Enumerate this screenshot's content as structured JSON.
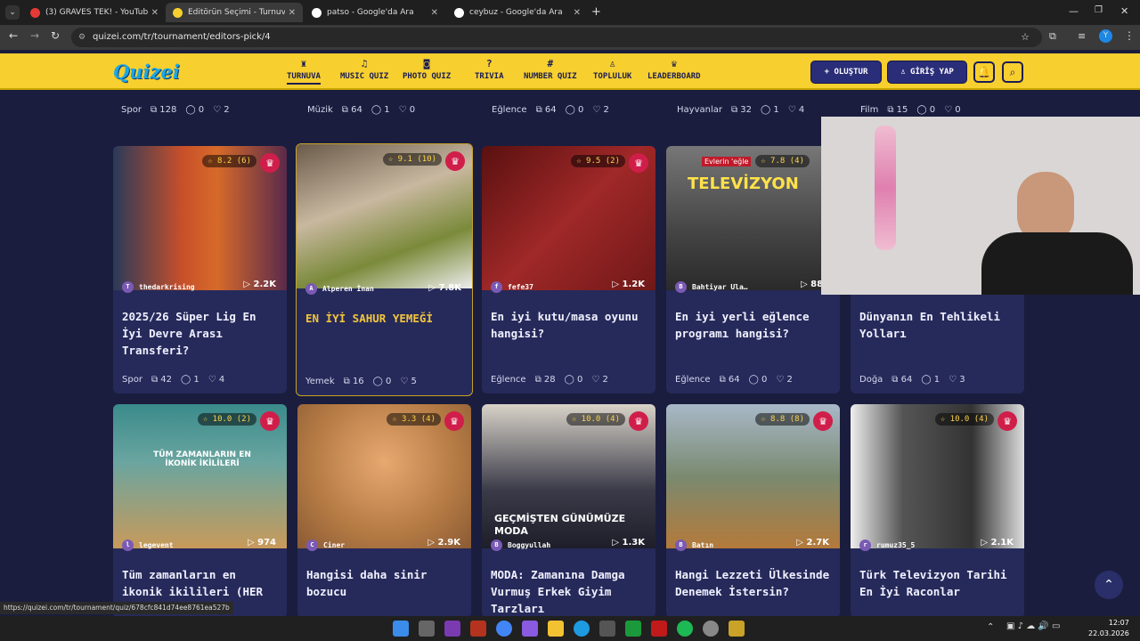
{
  "browser": {
    "tabs": [
      {
        "title": "(3) GRAVES TEK! - YouTube",
        "color": "#e53935"
      },
      {
        "title": "Editörün Seçimi - Turnuva - Qu",
        "color": "#f7cf2e"
      },
      {
        "title": "patso - Google'da Ara",
        "color": "#ffffff"
      },
      {
        "title": "ceybuz - Google'da Ara",
        "color": "#ffffff"
      }
    ],
    "url": "quizei.com/tr/tournament/editors-pick/4",
    "status_url": "https://quizei.com/tr/tournament/quiz/678cfc841d74ee8761ea527b"
  },
  "nav": {
    "logo": "Quizei",
    "items": [
      {
        "label": "TURNUVA",
        "icon": "♜"
      },
      {
        "label": "MUSIC QUIZ",
        "icon": "♫"
      },
      {
        "label": "PHOTO QUIZ",
        "icon": "◙"
      },
      {
        "label": "TRIVIA",
        "icon": "?"
      },
      {
        "label": "NUMBER QUIZ",
        "icon": "#"
      },
      {
        "label": "TOPLULUK",
        "icon": "♙"
      },
      {
        "label": "LEADERBOARD",
        "icon": "♛"
      }
    ],
    "create_label": "+ OLUŞTUR",
    "login_label": "♙ GİRİŞ YAP"
  },
  "top_row": [
    {
      "cat": "Spor",
      "q": "128",
      "c": "0",
      "l": "2"
    },
    {
      "cat": "Müzik",
      "q": "64",
      "c": "1",
      "l": "0"
    },
    {
      "cat": "Eğlence",
      "q": "64",
      "c": "0",
      "l": "2"
    },
    {
      "cat": "Hayvanlar",
      "q": "32",
      "c": "1",
      "l": "4"
    },
    {
      "cat": "Film",
      "q": "15",
      "c": "0",
      "l": "0"
    }
  ],
  "cards": [
    {
      "rating": "8.2 (6)",
      "author": "thedarkrising",
      "plays": "2.2K",
      "title": "2025/26 Süper Lig En İyi Devre Arası Transferi?",
      "cat": "Spor",
      "q": "42",
      "c": "1",
      "l": "4",
      "bg": "#b3472e"
    },
    {
      "rating": "9.1 (10)",
      "author": "Alperen İnan",
      "plays": "7.8K",
      "title": "EN İYİ SAHUR YEMEĞİ",
      "cat": "Yemek",
      "q": "16",
      "c": "0",
      "l": "5",
      "bg": "#a88a6a"
    },
    {
      "rating": "9.5 (2)",
      "author": "fefe37",
      "plays": "1.2K",
      "title": "En iyi kutu/masa oyunu hangisi?",
      "cat": "Eğlence",
      "q": "28",
      "c": "0",
      "l": "2",
      "bg": "#8a2020"
    },
    {
      "rating": "7.8 (4)",
      "author": "Bahtiyar Ula…",
      "plays": "889",
      "title": "En iyi yerli eğlence programı hangisi?",
      "cat": "Eğlence",
      "q": "64",
      "c": "0",
      "l": "2",
      "bg": "#555555"
    },
    {
      "rating": "",
      "author": "",
      "plays": "",
      "title": "Dünyanın En Tehlikeli Yolları",
      "cat": "Doğa",
      "q": "64",
      "c": "1",
      "l": "3",
      "bg": "#262a5a"
    },
    {
      "rating": "10.0 (2)",
      "author": "legevent",
      "plays": "974",
      "title": "Tüm zamanların en ikonik ikilileri (HER",
      "cat": "",
      "q": "",
      "c": "",
      "l": "",
      "bg": "#3a8b8b"
    },
    {
      "rating": "3.3 (4)",
      "author": "Ciner",
      "plays": "2.9K",
      "title": "Hangisi daha sinir bozucu",
      "cat": "",
      "q": "",
      "c": "",
      "l": "",
      "bg": "#c48a54"
    },
    {
      "rating": "10.0 (4)",
      "author": "Boggyullah",
      "plays": "1.3K",
      "title": "MODA: Zamanına Damga Vurmuş Erkek Giyim Tarzları",
      "cat": "",
      "q": "",
      "c": "",
      "l": "",
      "bg": "#cfc9bf"
    },
    {
      "rating": "8.8 (8)",
      "author": "Batın",
      "plays": "2.7K",
      "title": "Hangi Lezzeti Ülkesinde Denemek İstersin?",
      "cat": "",
      "q": "",
      "c": "",
      "l": "",
      "bg": "#8a6a3a"
    },
    {
      "rating": "10.0 (4)",
      "author": "rumuz35_5",
      "plays": "2.1K",
      "title": "Türk Televizyon Tarihi En İyi Raconlar",
      "cat": "",
      "q": "",
      "c": "",
      "l": "",
      "bg": "#555555"
    }
  ],
  "overlays": {
    "tv_text": "TELEVİZYON",
    "tv_banner": "Evlerin 'eğle",
    "moda_text": "GEÇMİŞTEN GÜNÜMÜZE MODA",
    "ikili_text": "TÜM ZAMANLARIN EN İKONİK İKİLİLERİ"
  },
  "taskbar": {
    "time": "12:07",
    "date": "22.03.2026"
  }
}
